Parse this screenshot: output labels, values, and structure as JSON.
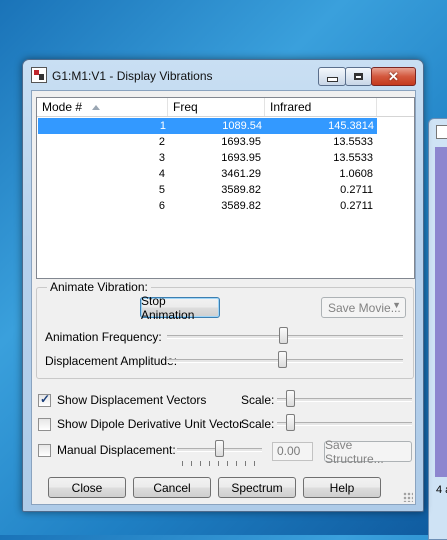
{
  "window": {
    "title": "G1:M1:V1 - Display Vibrations"
  },
  "table": {
    "columns": [
      "Mode #",
      "Freq",
      "Infrared"
    ],
    "rows": [
      {
        "mode": "1",
        "freq": "1089.54",
        "ir": "145.3814"
      },
      {
        "mode": "2",
        "freq": "1693.95",
        "ir": "13.5533"
      },
      {
        "mode": "3",
        "freq": "1693.95",
        "ir": "13.5533"
      },
      {
        "mode": "4",
        "freq": "3461.29",
        "ir": "1.0608"
      },
      {
        "mode": "5",
        "freq": "3589.82",
        "ir": "0.2711"
      },
      {
        "mode": "6",
        "freq": "3589.82",
        "ir": "0.2711"
      }
    ],
    "selected_row": 1
  },
  "animate": {
    "group_label": "Animate Vibration:",
    "stop_label": "Stop Animation",
    "save_movie_label": "Save Movie...",
    "frequency_label": "Animation Frequency:",
    "amplitude_label": "Displacement Amplitude:"
  },
  "options": {
    "show_vectors_label": "Show Displacement Vectors",
    "show_vectors_checked": true,
    "show_dipole_label": "Show Dipole Derivative Unit Vector",
    "show_dipole_checked": false,
    "scale_label": "Scale:",
    "manual_label": "Manual Displacement:",
    "manual_checked": false,
    "manual_value": "0.00",
    "save_structure_label": "Save Structure..."
  },
  "footer": {
    "close_label": "Close",
    "cancel_label": "Cancel",
    "spectrum_label": "Spectrum",
    "help_label": "Help"
  },
  "background_window": {
    "partial_text": "4 a"
  },
  "colors": {
    "selection": "#3399ff",
    "close_button": "#c43a1e"
  }
}
